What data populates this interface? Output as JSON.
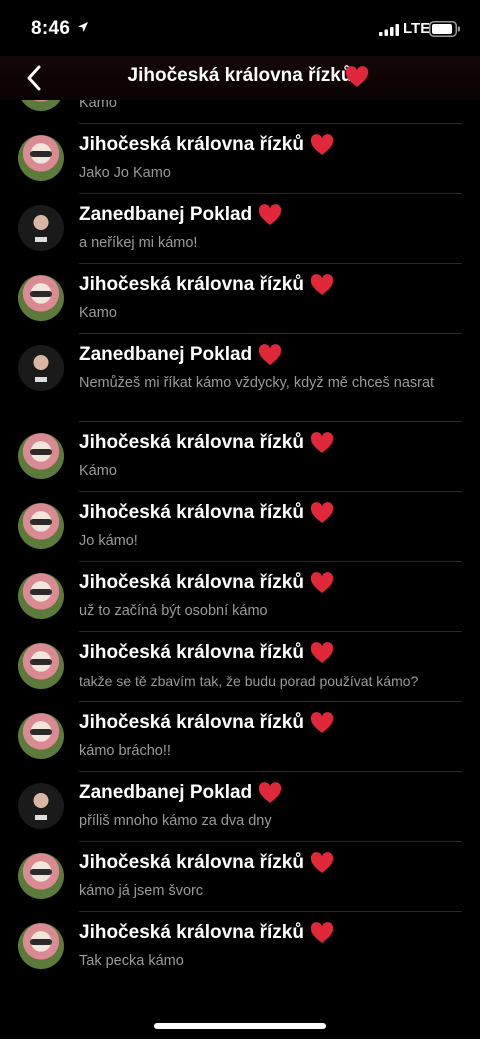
{
  "status": {
    "time": "8:46",
    "network": "LTE"
  },
  "nav": {
    "title": "Jihočeská královna řízků"
  },
  "messages": [
    {
      "sender": "Jihočeská královna řízků",
      "text": "Kamo",
      "avatar": "a"
    },
    {
      "sender": "Jihočeská královna řízků",
      "text": "Jako Jo Kamo",
      "avatar": "a"
    },
    {
      "sender": "Zanedbanej Poklad",
      "text": "a neříkej mi kámo!",
      "avatar": "b"
    },
    {
      "sender": "Jihočeská královna řízků",
      "text": "Kamo",
      "avatar": "a"
    },
    {
      "sender": "Zanedbanej Poklad",
      "text": "Nemůžeš mi říkat kámo vždycky, když mě chceš nasrat",
      "avatar": "b"
    },
    {
      "sender": "Jihočeská královna řízků",
      "text": "Kámo",
      "avatar": "a"
    },
    {
      "sender": "Jihočeská královna řízků",
      "text": "Jo kámo!",
      "avatar": "a"
    },
    {
      "sender": "Jihočeská královna řízků",
      "text": "už to začíná být osobní kámo",
      "avatar": "a"
    },
    {
      "sender": "Jihočeská královna řízků",
      "text": "takže se tě zbavím tak, že budu porad používat kámo?",
      "avatar": "a"
    },
    {
      "sender": "Jihočeská královna řízků",
      "text": "kámo brácho!!",
      "avatar": "a"
    },
    {
      "sender": "Zanedbanej Poklad",
      "text": "příliš mnoho kámo za dva dny",
      "avatar": "b"
    },
    {
      "sender": "Jihočeská královna řízků",
      "text": "kámo já jsem švorc",
      "avatar": "a"
    },
    {
      "sender": "Jihočeská královna řízků",
      "text": "Tak pecka kámo",
      "avatar": "a"
    }
  ],
  "colors": {
    "heart": "#e0283a",
    "secondary_text": "#9a9a9a",
    "separator": "#2b2b2b"
  }
}
